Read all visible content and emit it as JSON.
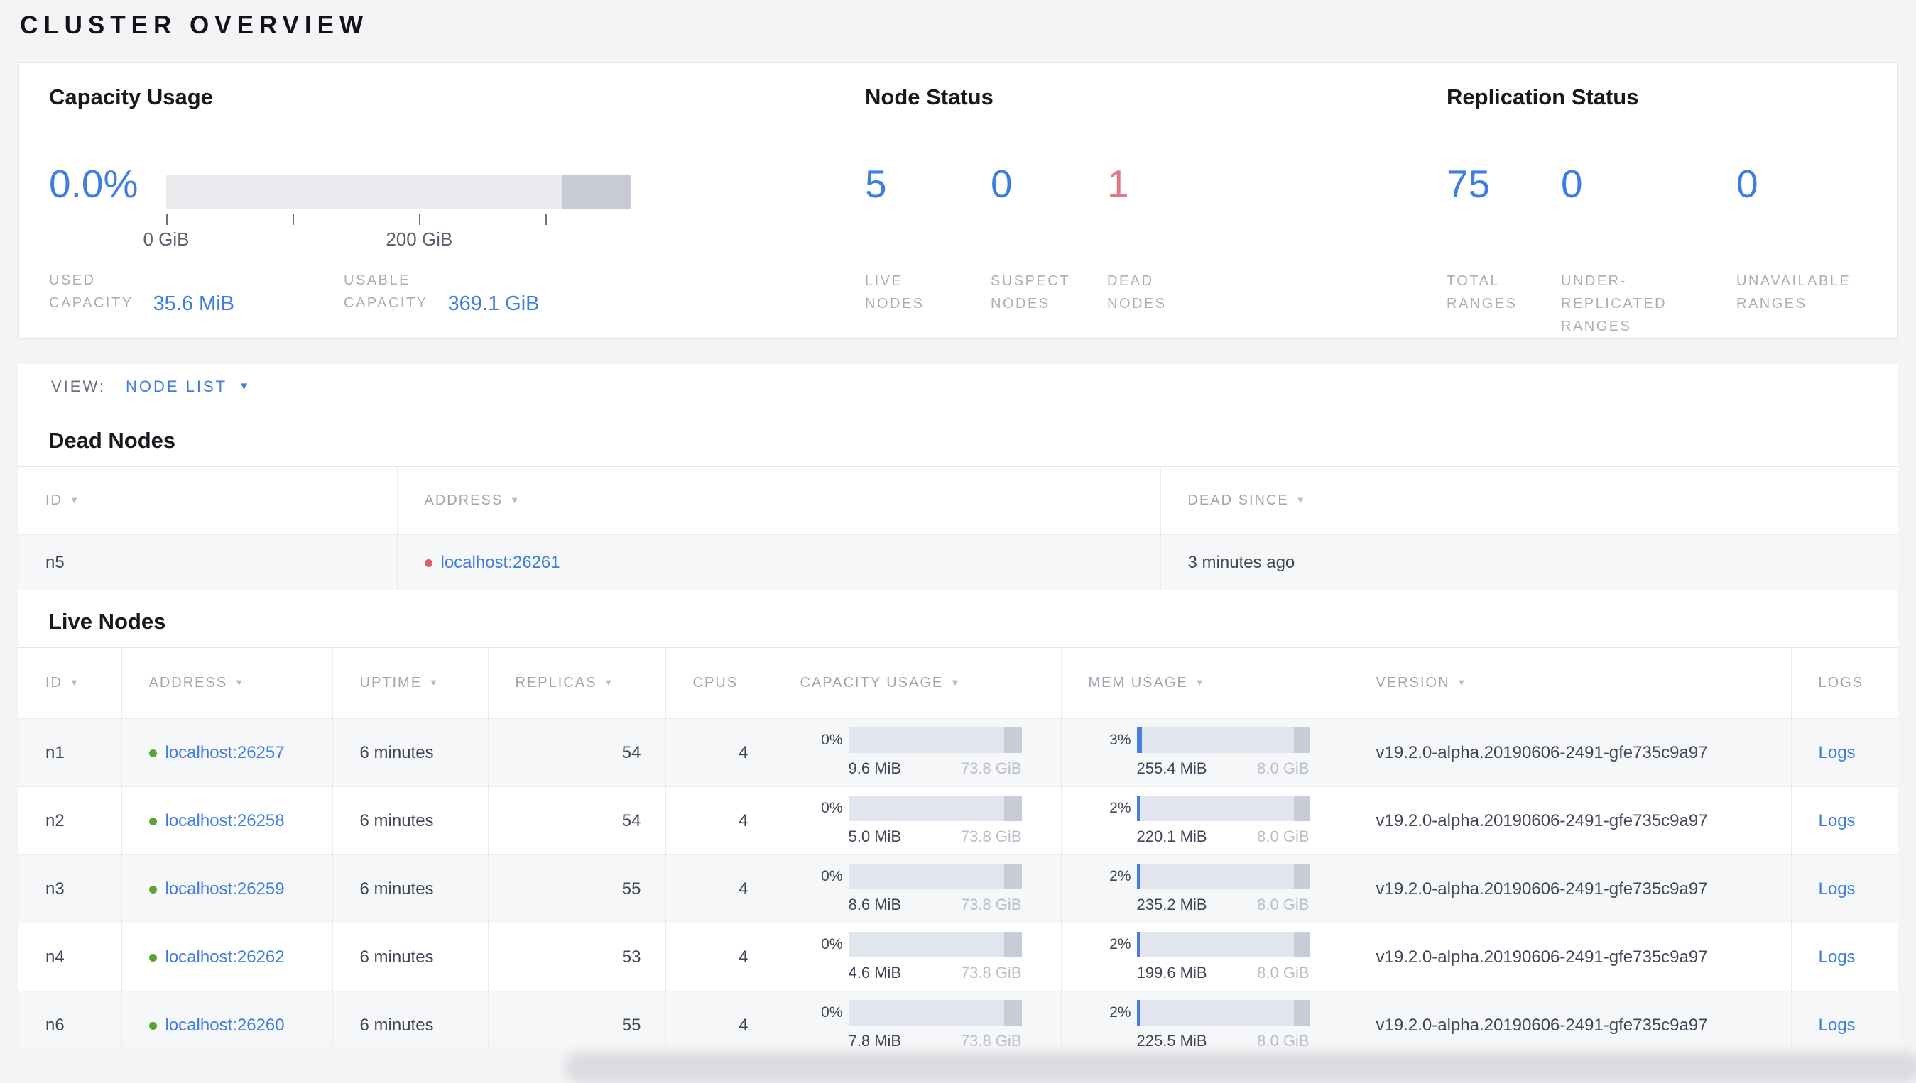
{
  "page": {
    "title": "CLUSTER OVERVIEW"
  },
  "colors": {
    "blue": "#3f7de1",
    "red": "#de7887",
    "dot_red": "#d95f6c",
    "dot_green": "#5aa33a"
  },
  "summary": {
    "capacity": {
      "title": "Capacity Usage",
      "percent": "0.0%",
      "bar": {
        "reserved_pct": 15,
        "ticks": [
          {
            "pos": 0,
            "label": "0 GiB"
          },
          {
            "pos": 27.2,
            "label": ""
          },
          {
            "pos": 54.4,
            "label": "200 GiB"
          },
          {
            "pos": 81.6,
            "label": ""
          }
        ]
      },
      "stats": [
        {
          "label": "USED\nCAPACITY",
          "value": "35.6 MiB"
        },
        {
          "label": "USABLE\nCAPACITY",
          "value": "369.1 GiB"
        }
      ]
    },
    "node_status": {
      "title": "Node Status",
      "metrics": [
        {
          "value": "5",
          "label": "LIVE\nNODES",
          "color": "blue"
        },
        {
          "value": "0",
          "label": "SUSPECT\nNODES",
          "color": "blue"
        },
        {
          "value": "1",
          "label": "DEAD\nNODES",
          "color": "red"
        }
      ]
    },
    "replication": {
      "title": "Replication Status",
      "metrics": [
        {
          "value": "75",
          "label": "TOTAL\nRANGES",
          "color": "blue"
        },
        {
          "value": "0",
          "label": "UNDER-\nREPLICATED\nRANGES",
          "color": "blue"
        },
        {
          "value": "0",
          "label": "UNAVAILABLE\nRANGES",
          "color": "blue"
        }
      ]
    }
  },
  "view_bar": {
    "label": "VIEW:",
    "selected": "NODE LIST"
  },
  "dead_nodes": {
    "heading": "Dead Nodes",
    "columns": [
      {
        "key": "id",
        "label": "ID",
        "sort": true
      },
      {
        "key": "address",
        "label": "ADDRESS",
        "sort": true
      },
      {
        "key": "dead_since",
        "label": "DEAD SINCE",
        "sort": true
      }
    ],
    "rows": [
      {
        "id": "n5",
        "address": "localhost:26261",
        "dead_since": "3 minutes ago"
      }
    ]
  },
  "live_nodes": {
    "heading": "Live Nodes",
    "columns": [
      {
        "key": "id",
        "label": "ID",
        "sort": true
      },
      {
        "key": "address",
        "label": "ADDRESS",
        "sort": true
      },
      {
        "key": "uptime",
        "label": "UPTIME",
        "sort": true
      },
      {
        "key": "replicas",
        "label": "REPLICAS",
        "sort": true
      },
      {
        "key": "cpus",
        "label": "CPUS",
        "sort": false
      },
      {
        "key": "capacity",
        "label": "CAPACITY USAGE",
        "sort": true
      },
      {
        "key": "memory",
        "label": "MEM USAGE",
        "sort": true
      },
      {
        "key": "version",
        "label": "VERSION",
        "sort": true
      },
      {
        "key": "logs",
        "label": "LOGS",
        "sort": false
      }
    ],
    "rows": [
      {
        "id": "n1",
        "address": "localhost:26257",
        "uptime": "6 minutes",
        "replicas": "54",
        "cpus": "4",
        "capacity": {
          "percent": "0%",
          "fill_pct": 0,
          "reserved_pct": 10,
          "used": "9.6 MiB",
          "total": "73.8 GiB"
        },
        "memory": {
          "percent": "3%",
          "fill_pct": 3,
          "reserved_pct": 9,
          "used": "255.4 MiB",
          "total": "8.0 GiB"
        },
        "version": "v19.2.0-alpha.20190606-2491-gfe735c9a97",
        "logs": "Logs"
      },
      {
        "id": "n2",
        "address": "localhost:26258",
        "uptime": "6 minutes",
        "replicas": "54",
        "cpus": "4",
        "capacity": {
          "percent": "0%",
          "fill_pct": 0,
          "reserved_pct": 10,
          "used": "5.0 MiB",
          "total": "73.8 GiB"
        },
        "memory": {
          "percent": "2%",
          "fill_pct": 2,
          "reserved_pct": 9,
          "used": "220.1 MiB",
          "total": "8.0 GiB"
        },
        "version": "v19.2.0-alpha.20190606-2491-gfe735c9a97",
        "logs": "Logs"
      },
      {
        "id": "n3",
        "address": "localhost:26259",
        "uptime": "6 minutes",
        "replicas": "55",
        "cpus": "4",
        "capacity": {
          "percent": "0%",
          "fill_pct": 0,
          "reserved_pct": 10,
          "used": "8.6 MiB",
          "total": "73.8 GiB"
        },
        "memory": {
          "percent": "2%",
          "fill_pct": 2,
          "reserved_pct": 9,
          "used": "235.2 MiB",
          "total": "8.0 GiB"
        },
        "version": "v19.2.0-alpha.20190606-2491-gfe735c9a97",
        "logs": "Logs"
      },
      {
        "id": "n4",
        "address": "localhost:26262",
        "uptime": "6 minutes",
        "replicas": "53",
        "cpus": "4",
        "capacity": {
          "percent": "0%",
          "fill_pct": 0,
          "reserved_pct": 10,
          "used": "4.6 MiB",
          "total": "73.8 GiB"
        },
        "memory": {
          "percent": "2%",
          "fill_pct": 2,
          "reserved_pct": 9,
          "used": "199.6 MiB",
          "total": "8.0 GiB"
        },
        "version": "v19.2.0-alpha.20190606-2491-gfe735c9a97",
        "logs": "Logs"
      },
      {
        "id": "n6",
        "address": "localhost:26260",
        "uptime": "6 minutes",
        "replicas": "55",
        "cpus": "4",
        "capacity": {
          "percent": "0%",
          "fill_pct": 0,
          "reserved_pct": 10,
          "used": "7.8 MiB",
          "total": "73.8 GiB"
        },
        "memory": {
          "percent": "2%",
          "fill_pct": 2,
          "reserved_pct": 9,
          "used": "225.5 MiB",
          "total": "8.0 GiB"
        },
        "version": "v19.2.0-alpha.20190606-2491-gfe735c9a97",
        "logs": "Logs"
      }
    ]
  }
}
